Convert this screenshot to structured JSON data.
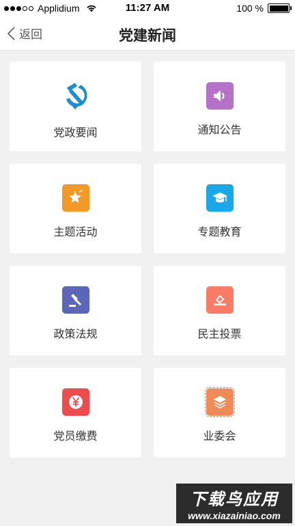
{
  "status_bar": {
    "carrier": "Applidium",
    "time": "11:27 AM",
    "battery": "100 %"
  },
  "nav": {
    "back_label": "返回",
    "title": "党建新闻"
  },
  "tiles": [
    {
      "label": "党政要闻",
      "icon": "hammer-sickle-icon",
      "color": "#1a8fd6"
    },
    {
      "label": "通知公告",
      "icon": "speaker-icon",
      "color": "#b572c8"
    },
    {
      "label": "主题活动",
      "icon": "star-icon",
      "color": "#f39a26"
    },
    {
      "label": "专题教育",
      "icon": "graduation-cap-icon",
      "color": "#1aa8e8"
    },
    {
      "label": "政策法规",
      "icon": "gavel-icon",
      "color": "#5b66b8"
    },
    {
      "label": "民主投票",
      "icon": "vote-icon",
      "color": "#f97c66"
    },
    {
      "label": "党员缴费",
      "icon": "yen-icon",
      "color": "#ee4b4f"
    },
    {
      "label": "业委会",
      "icon": "layers-icon",
      "color": "#f08b57"
    }
  ],
  "watermark": {
    "title": "下载鸟应用",
    "url": "www.xiazainiao.com"
  }
}
